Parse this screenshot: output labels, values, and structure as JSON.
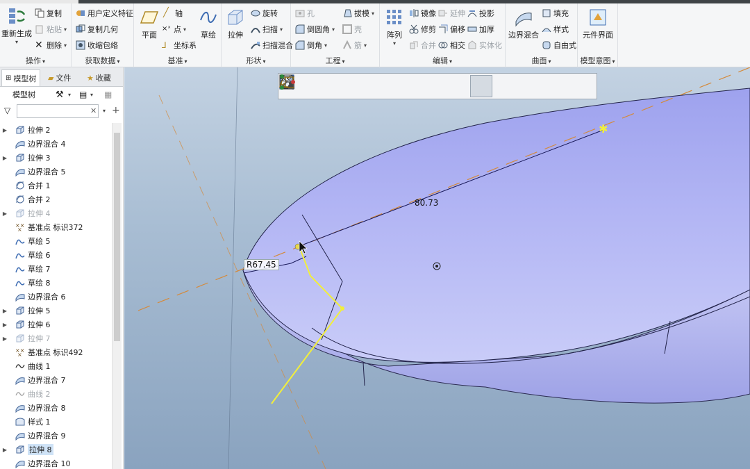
{
  "ribbon": {
    "operations": {
      "label": "操作",
      "regen": "重新生成",
      "copy": "复制",
      "paste": "粘贴",
      "delete": "删除"
    },
    "get_data": {
      "label": "获取数据",
      "udf": "用户定义特征",
      "copy_geom": "复制几何",
      "shrinkwrap": "收缩包络"
    },
    "datum": {
      "label": "基准",
      "plane": "平面",
      "axis": "轴",
      "point": "点",
      "csys": "坐标系",
      "sketch": "草绘"
    },
    "shapes": {
      "label": "形状",
      "extrude": "拉伸",
      "revolve": "旋转",
      "sweep": "扫描",
      "swept_blend": "扫描混合"
    },
    "engineering": {
      "label": "工程",
      "hole": "孔",
      "draft": "拔模",
      "round": "倒圆角",
      "shell": "壳",
      "chamfer": "倒角",
      "rib": "筋"
    },
    "editing": {
      "label": "编辑",
      "pattern": "阵列",
      "mirror": "镜像",
      "extend": "延伸",
      "project": "投影",
      "trim": "修剪",
      "offset": "偏移",
      "thicken": "加厚",
      "merge": "合并",
      "intersect": "相交",
      "solidify": "实体化"
    },
    "surfaces": {
      "label": "曲面",
      "boundary_blend": "边界混合",
      "fill": "填充",
      "style": "样式",
      "freestyle": "自由式"
    },
    "model_intent": {
      "label": "模型意图",
      "component_interface": "元件界面"
    }
  },
  "left_panel": {
    "tabs": [
      "模型树",
      "文件",
      "收藏"
    ],
    "tree_header": "模型树",
    "filter_placeholder": "",
    "items": [
      {
        "label": "拉伸 2",
        "icon": "extrude-icon",
        "expand": true,
        "disabled": false,
        "selected": false
      },
      {
        "label": "边界混合 4",
        "icon": "boundary-blend-icon",
        "expand": false,
        "disabled": false,
        "selected": false
      },
      {
        "label": "拉伸 3",
        "icon": "extrude-icon",
        "expand": true,
        "disabled": false,
        "selected": false
      },
      {
        "label": "边界混合 5",
        "icon": "boundary-blend-icon",
        "expand": false,
        "disabled": false,
        "selected": false
      },
      {
        "label": "合并 1",
        "icon": "merge-icon",
        "expand": false,
        "disabled": false,
        "selected": false
      },
      {
        "label": "合并 2",
        "icon": "merge-icon",
        "expand": false,
        "disabled": false,
        "selected": false
      },
      {
        "label": "拉伸 4",
        "icon": "extrude-icon",
        "expand": true,
        "disabled": true,
        "selected": false
      },
      {
        "label": "基准点 标识372",
        "icon": "datum-point-icon",
        "expand": false,
        "disabled": false,
        "selected": false
      },
      {
        "label": "草绘 5",
        "icon": "sketch-icon",
        "expand": false,
        "disabled": false,
        "selected": false
      },
      {
        "label": "草绘 6",
        "icon": "sketch-icon",
        "expand": false,
        "disabled": false,
        "selected": false
      },
      {
        "label": "草绘 7",
        "icon": "sketch-icon",
        "expand": false,
        "disabled": false,
        "selected": false
      },
      {
        "label": "草绘 8",
        "icon": "sketch-icon",
        "expand": false,
        "disabled": false,
        "selected": false
      },
      {
        "label": "边界混合 6",
        "icon": "boundary-blend-icon",
        "expand": false,
        "disabled": false,
        "selected": false
      },
      {
        "label": "拉伸 5",
        "icon": "extrude-icon",
        "expand": true,
        "disabled": false,
        "selected": false
      },
      {
        "label": "拉伸 6",
        "icon": "extrude-icon",
        "expand": true,
        "disabled": false,
        "selected": false
      },
      {
        "label": "拉伸 7",
        "icon": "extrude-icon",
        "expand": true,
        "disabled": true,
        "selected": false
      },
      {
        "label": "基准点 标识492",
        "icon": "datum-point-icon",
        "expand": false,
        "disabled": false,
        "selected": false
      },
      {
        "label": "曲线 1",
        "icon": "curve-icon",
        "expand": false,
        "disabled": false,
        "selected": false
      },
      {
        "label": "边界混合 7",
        "icon": "boundary-blend-icon",
        "expand": false,
        "disabled": false,
        "selected": false
      },
      {
        "label": "曲线 2",
        "icon": "curve-icon",
        "expand": false,
        "disabled": true,
        "selected": false
      },
      {
        "label": "边界混合 8",
        "icon": "boundary-blend-icon",
        "expand": false,
        "disabled": false,
        "selected": false
      },
      {
        "label": "样式 1",
        "icon": "style-icon",
        "expand": false,
        "disabled": false,
        "selected": false
      },
      {
        "label": "边界混合 9",
        "icon": "boundary-blend-icon",
        "expand": false,
        "disabled": false,
        "selected": false
      },
      {
        "label": "拉伸 8",
        "icon": "extrude-icon",
        "expand": true,
        "disabled": false,
        "selected": true
      },
      {
        "label": "边界混合 10",
        "icon": "boundary-blend-icon",
        "expand": false,
        "disabled": false,
        "selected": false
      }
    ]
  },
  "viewport": {
    "dimension_length": "80.73",
    "dimension_radius": "R67.45"
  },
  "colors": {
    "accent": "#2b6cb0",
    "surface": "#a9aef0",
    "sketch_yellow": "#f2ef3a",
    "datum_orange": "#d48a3c"
  }
}
